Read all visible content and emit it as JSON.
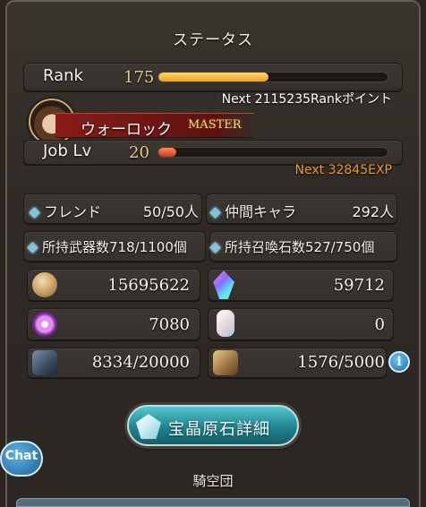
{
  "header": {
    "title": "ステータス"
  },
  "rank": {
    "label": "Rank",
    "value": "175",
    "progress": 0.48,
    "next_text": "Next 2115235Rankポイント"
  },
  "job": {
    "name": "ウォーロック",
    "badge": "MASTER",
    "level_label": "Job Lv",
    "level": "20",
    "progress": 0.08,
    "next_text": "Next 32845EXP"
  },
  "stats": {
    "friends_label": "フレンド",
    "friends_value": "50/50人",
    "characters_label": "仲間キャラ",
    "characters_value": "292人",
    "weapons_text": "所持武器数718/1100個",
    "summons_text": "所持召喚石数527/750個"
  },
  "currencies": {
    "rupie": "15695622",
    "crystal": "59712",
    "renown": "7080",
    "silver_crystal": "0",
    "prestige": "8334/20000",
    "honor": "1576/5000"
  },
  "buttons": {
    "detail_label": "宝晶原石詳細",
    "chat_label": "Chat",
    "info_label": "i"
  },
  "footer": {
    "crew_title": "騎空団"
  },
  "colors": {
    "rank_bar": "#f4b430",
    "exp_bar": "#e0502a",
    "next_rank_text": "#ffffff",
    "next_exp_text": "#f0962a",
    "accent_diamond": "#7fc3de"
  }
}
